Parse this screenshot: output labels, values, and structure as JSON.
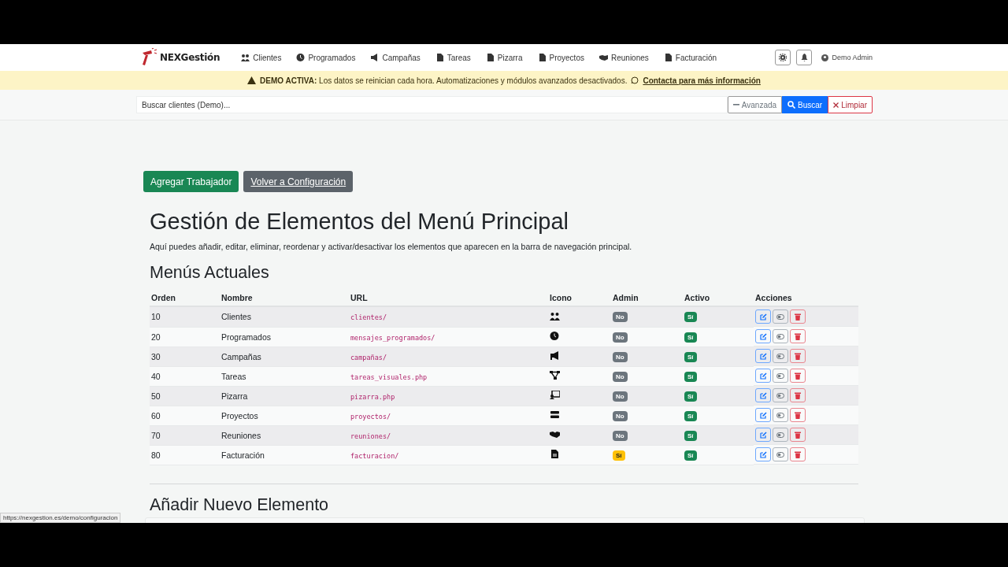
{
  "brand": "NEXGestión",
  "nav": [
    {
      "label": "Clientes"
    },
    {
      "label": "Programados"
    },
    {
      "label": "Campañas"
    },
    {
      "label": "Tareas"
    },
    {
      "label": "Pizarra"
    },
    {
      "label": "Proyectos"
    },
    {
      "label": "Reuniones"
    },
    {
      "label": "Facturación"
    }
  ],
  "user": "Demo Admin",
  "banner": {
    "strong": "DEMO ACTIVA:",
    "text": "Los datos se reinician cada hora. Automatizaciones y módulos avanzados desactivados.",
    "link": "Contacta para más información"
  },
  "search": {
    "placeholder": "Buscar clientes (Demo)...",
    "buttons": [
      "Avanzada",
      "Buscar",
      "Limpiar"
    ]
  },
  "actions": [
    {
      "label": "Agregar Trabajador",
      "kind": "primary"
    },
    {
      "label": "Volver a Configuración",
      "kind": "secondary"
    }
  ],
  "title": "Gestión de Elementos del Menú Principal",
  "intro": "Aquí puedes añadir, editar, eliminar, reordenar y activar/desactivar los elementos que aparecen en la barra de navegación principal.",
  "section": "Menús Actuales",
  "table": {
    "columns": [
      "Orden",
      "Nombre",
      "URL",
      "Icono",
      "Admin",
      "Activo",
      "Acciones"
    ],
    "rows": [
      {
        "order": "10",
        "name": "Clientes",
        "url": "clientes/",
        "admin": {
          "text": "No",
          "on": false
        },
        "active": {
          "text": "Sí",
          "on": true
        }
      },
      {
        "order": "20",
        "name": "Programados",
        "url": "mensajes_programados/",
        "admin": {
          "text": "No",
          "on": false
        },
        "active": {
          "text": "Sí",
          "on": true
        }
      },
      {
        "order": "30",
        "name": "Campañas",
        "url": "campañas/",
        "admin": {
          "text": "No",
          "on": false
        },
        "active": {
          "text": "Sí",
          "on": true
        }
      },
      {
        "order": "40",
        "name": "Tareas",
        "url": "tareas_visuales.php",
        "admin": {
          "text": "No",
          "on": false
        },
        "active": {
          "text": "Sí",
          "on": true
        }
      },
      {
        "order": "50",
        "name": "Pizarra",
        "url": "pizarra.php",
        "admin": {
          "text": "No",
          "on": false
        },
        "active": {
          "text": "Sí",
          "on": true
        }
      },
      {
        "order": "60",
        "name": "Proyectos",
        "url": "proyectos/",
        "admin": {
          "text": "No",
          "on": false
        },
        "active": {
          "text": "Sí",
          "on": true
        }
      },
      {
        "order": "70",
        "name": "Reuniones",
        "url": "reuniones/",
        "admin": {
          "text": "No",
          "on": false
        },
        "active": {
          "text": "Sí",
          "on": true
        }
      },
      {
        "order": "80",
        "name": "Facturación",
        "url": "facturacion/",
        "admin": {
          "text": "Sí",
          "on": true
        },
        "active": {
          "text": "Sí",
          "on": true
        }
      }
    ]
  },
  "section2": "Añadir Nuevo Elemento",
  "status_url": "https://nexgestion.es/demo/configuracion"
}
